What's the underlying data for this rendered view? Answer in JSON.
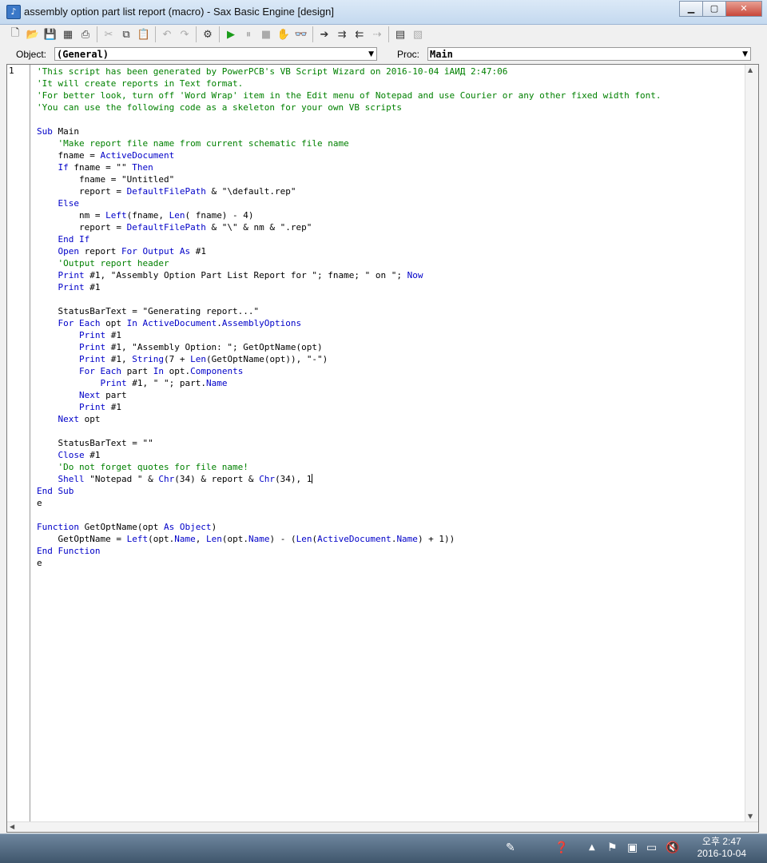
{
  "window": {
    "title": "assembly option part list report (macro) - Sax Basic Engine [design]"
  },
  "objectbar": {
    "object_label": "Object:",
    "object_value": "(General)",
    "proc_label": "Proc:",
    "proc_value": "Main"
  },
  "editor": {
    "line_number": "1"
  },
  "code": {
    "lines": [
      [
        [
          "c",
          "'This script has been generated by PowerPCB's VB Script Wizard on 2016-10-04 îАИД 2:47:06"
        ]
      ],
      [
        [
          "c",
          "'It will create reports in Text format."
        ]
      ],
      [
        [
          "c",
          "'For better look, turn off 'Word Wrap' item in the Edit menu of Notepad and use Courier or any other fixed width font."
        ]
      ],
      [
        [
          "c",
          "'You can use the following code as a skeleton for your own VB scripts"
        ]
      ],
      [],
      [
        [
          "k",
          "Sub"
        ],
        [
          "p",
          " Main"
        ]
      ],
      [
        [
          "p",
          "    "
        ],
        [
          "c",
          "'Make report file name from current schematic file name"
        ]
      ],
      [
        [
          "p",
          "    fname = "
        ],
        [
          "k",
          "ActiveDocument"
        ]
      ],
      [
        [
          "p",
          "    "
        ],
        [
          "k",
          "If"
        ],
        [
          "p",
          " fname = \"\" "
        ],
        [
          "k",
          "Then"
        ]
      ],
      [
        [
          "p",
          "        fname = \"Untitled\""
        ]
      ],
      [
        [
          "p",
          "        report = "
        ],
        [
          "k",
          "DefaultFilePath"
        ],
        [
          "p",
          " & \"\\default.rep\""
        ]
      ],
      [
        [
          "p",
          "    "
        ],
        [
          "k",
          "Else"
        ]
      ],
      [
        [
          "p",
          "        nm = "
        ],
        [
          "k",
          "Left"
        ],
        [
          "p",
          "(fname, "
        ],
        [
          "k",
          "Len"
        ],
        [
          "p",
          "( fname) - 4)"
        ]
      ],
      [
        [
          "p",
          "        report = "
        ],
        [
          "k",
          "DefaultFilePath"
        ],
        [
          "p",
          " & \"\\\" & nm & \".rep\""
        ]
      ],
      [
        [
          "p",
          "    "
        ],
        [
          "k",
          "End If"
        ]
      ],
      [
        [
          "p",
          "    "
        ],
        [
          "k",
          "Open"
        ],
        [
          "p",
          " report "
        ],
        [
          "k",
          "For Output As"
        ],
        [
          "p",
          " #1"
        ]
      ],
      [
        [
          "p",
          "    "
        ],
        [
          "c",
          "'Output report header"
        ]
      ],
      [
        [
          "p",
          "    "
        ],
        [
          "k",
          "Print"
        ],
        [
          "p",
          " #1, \"Assembly Option Part List Report for \"; fname; \" on \"; "
        ],
        [
          "k",
          "Now"
        ]
      ],
      [
        [
          "p",
          "    "
        ],
        [
          "k",
          "Print"
        ],
        [
          "p",
          " #1"
        ]
      ],
      [],
      [
        [
          "p",
          "    StatusBarText = \"Generating report...\""
        ]
      ],
      [
        [
          "p",
          "    "
        ],
        [
          "k",
          "For Each"
        ],
        [
          "p",
          " opt "
        ],
        [
          "k",
          "In"
        ],
        [
          "p",
          " "
        ],
        [
          "k",
          "ActiveDocument"
        ],
        [
          "p",
          "."
        ],
        [
          "k",
          "AssemblyOptions"
        ]
      ],
      [
        [
          "p",
          "        "
        ],
        [
          "k",
          "Print"
        ],
        [
          "p",
          " #1"
        ]
      ],
      [
        [
          "p",
          "        "
        ],
        [
          "k",
          "Print"
        ],
        [
          "p",
          " #1, \"Assembly Option: \"; GetOptName(opt)"
        ]
      ],
      [
        [
          "p",
          "        "
        ],
        [
          "k",
          "Print"
        ],
        [
          "p",
          " #1, "
        ],
        [
          "k",
          "String"
        ],
        [
          "p",
          "(7 + "
        ],
        [
          "k",
          "Len"
        ],
        [
          "p",
          "(GetOptName(opt)), \"-\")"
        ]
      ],
      [
        [
          "p",
          "        "
        ],
        [
          "k",
          "For Each"
        ],
        [
          "p",
          " part "
        ],
        [
          "k",
          "In"
        ],
        [
          "p",
          " opt."
        ],
        [
          "k",
          "Components"
        ]
      ],
      [
        [
          "p",
          "            "
        ],
        [
          "k",
          "Print"
        ],
        [
          "p",
          " #1, \" \"; part."
        ],
        [
          "k",
          "Name"
        ]
      ],
      [
        [
          "p",
          "        "
        ],
        [
          "k",
          "Next"
        ],
        [
          "p",
          " part"
        ]
      ],
      [
        [
          "p",
          "        "
        ],
        [
          "k",
          "Print"
        ],
        [
          "p",
          " #1"
        ]
      ],
      [
        [
          "p",
          "    "
        ],
        [
          "k",
          "Next"
        ],
        [
          "p",
          " opt"
        ]
      ],
      [],
      [
        [
          "p",
          "    StatusBarText = \"\""
        ]
      ],
      [
        [
          "p",
          "    "
        ],
        [
          "k",
          "Close"
        ],
        [
          "p",
          " #1"
        ]
      ],
      [
        [
          "p",
          "    "
        ],
        [
          "c",
          "'Do not forget quotes for file name!"
        ]
      ],
      [
        [
          "p",
          "    "
        ],
        [
          "k",
          "Shell"
        ],
        [
          "p",
          " \"Notepad \" & "
        ],
        [
          "k",
          "Chr"
        ],
        [
          "p",
          "(34) & report & "
        ],
        [
          "k",
          "Chr"
        ],
        [
          "p",
          "(34), 1"
        ],
        [
          "cursor",
          ""
        ]
      ],
      [
        [
          "k",
          "End Sub"
        ]
      ],
      [
        "sep"
      ],
      [],
      [
        [
          "k",
          "Function"
        ],
        [
          "p",
          " GetOptName(opt "
        ],
        [
          "k",
          "As Object"
        ],
        [
          "p",
          ")"
        ]
      ],
      [
        [
          "p",
          "    GetOptName = "
        ],
        [
          "k",
          "Left"
        ],
        [
          "p",
          "(opt."
        ],
        [
          "k",
          "Name"
        ],
        [
          "p",
          ", "
        ],
        [
          "k",
          "Len"
        ],
        [
          "p",
          "(opt."
        ],
        [
          "k",
          "Name"
        ],
        [
          "p",
          ") - ("
        ],
        [
          "k",
          "Len"
        ],
        [
          "p",
          "("
        ],
        [
          "k",
          "ActiveDocument"
        ],
        [
          "p",
          "."
        ],
        [
          "k",
          "Name"
        ],
        [
          "p",
          ") + 1))"
        ]
      ],
      [
        [
          "k",
          "End Function"
        ]
      ],
      [
        "sep"
      ]
    ]
  },
  "taskbar": {
    "time": "오후 2:47",
    "date": "2016-10-04"
  }
}
